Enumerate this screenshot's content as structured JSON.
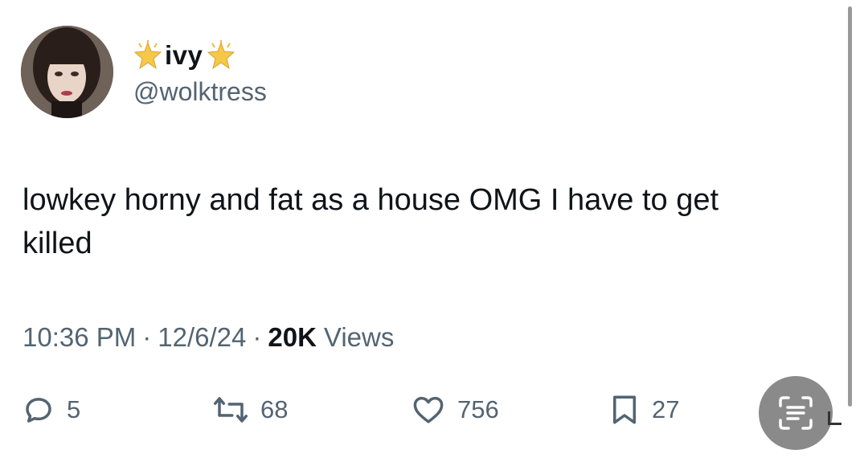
{
  "author": {
    "display_name": "ivy",
    "handle": "@wolktress",
    "avatar_icon": "profile-photo",
    "name_decoration_icon": "sparkle-star-emoji"
  },
  "tweet": {
    "text": "lowkey horny and fat as a house OMG I have to get\nkilled"
  },
  "meta": {
    "time": "10:36 PM",
    "separator": "·",
    "date": "12/6/24",
    "views_count": "20K",
    "views_label": "Views"
  },
  "actions": {
    "replies": "5",
    "retweets": "68",
    "likes": "756",
    "bookmarks": "27"
  },
  "colors": {
    "text_primary": "#0f1419",
    "text_secondary": "#536471",
    "scan_button_bg": "#8a8a8a"
  }
}
